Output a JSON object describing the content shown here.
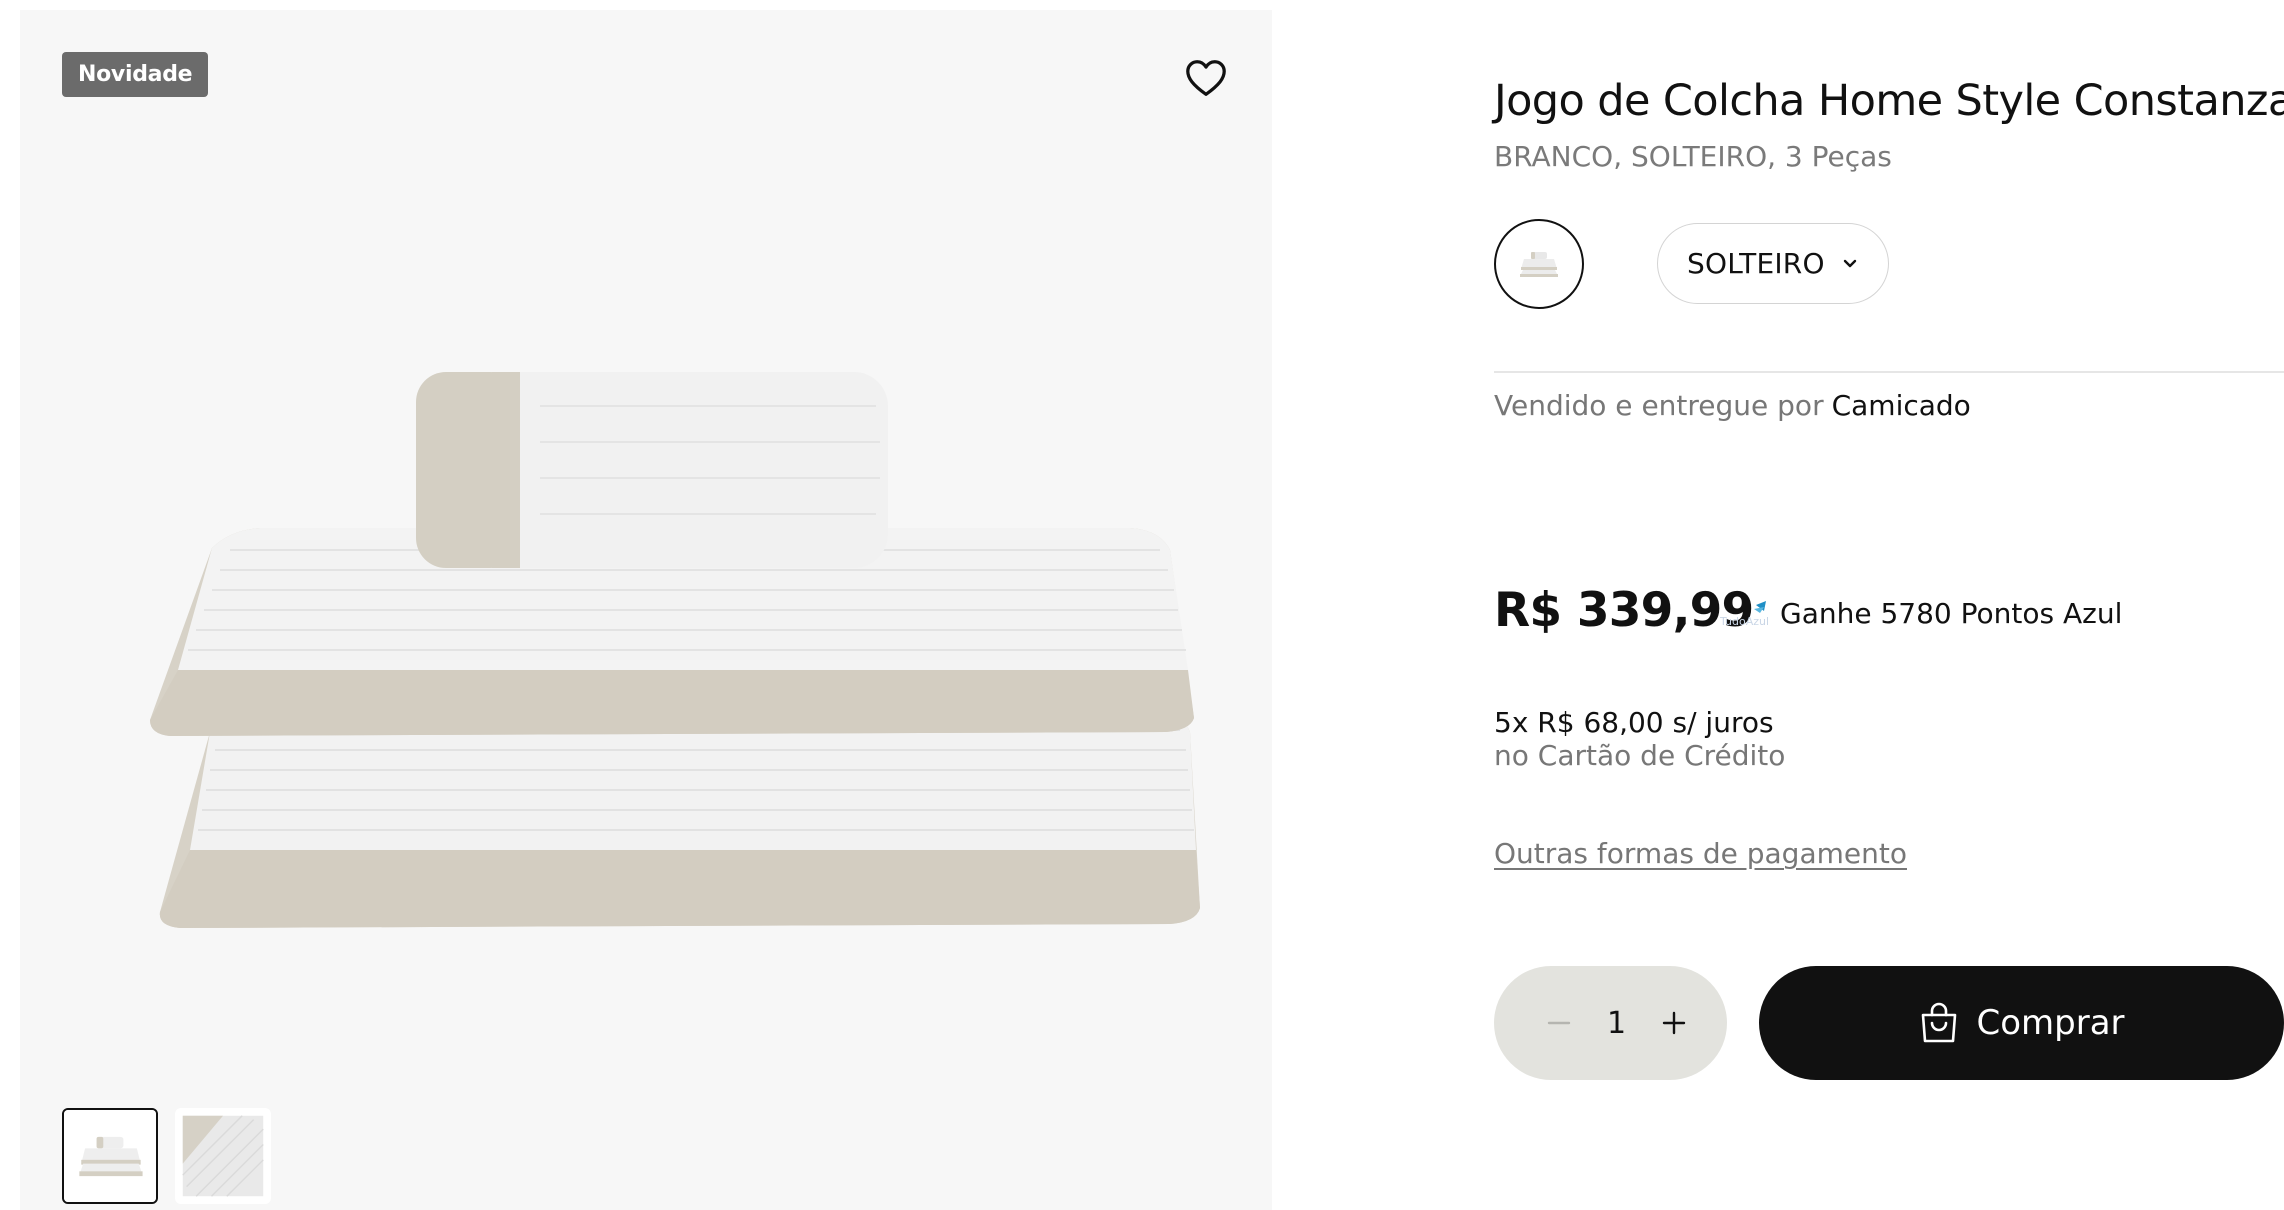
{
  "gallery": {
    "badge": "Novidade",
    "favorite_icon": "heart-icon",
    "thumbnail_count": 2,
    "selected_thumbnail": 1
  },
  "product": {
    "title": "Jogo de Colcha Home Style Constanza",
    "variant_line": "BRANCO, SOLTEIRO, 3 Peças"
  },
  "options": {
    "size_selected": "SOLTEIRO",
    "size_icon": "chevron-down-icon"
  },
  "seller": {
    "prefix": "Vendido e entregue por",
    "name": "Camicado"
  },
  "pricing": {
    "price": "R$ 339,99",
    "points_logo_text": "TudoAzul",
    "points": "Ganhe 5780 Pontos Azul",
    "installments": "5x R$ 68,00 s/ juros",
    "installments_method": "no Cartão de Crédito",
    "other_payments": "Outras formas de pagamento"
  },
  "cart": {
    "quantity": "1",
    "buy_label": "Comprar",
    "buy_icon": "shopping-bag-icon"
  },
  "colors": {
    "primary": "#111111",
    "muted_text": "#777777",
    "stepper_bg": "#e3e3de",
    "badge_bg": "#6b6b6b",
    "gallery_bg": "#f7f7f7",
    "fabric_white": "#f3f3f3",
    "fabric_beige": "#d6d1c6"
  }
}
